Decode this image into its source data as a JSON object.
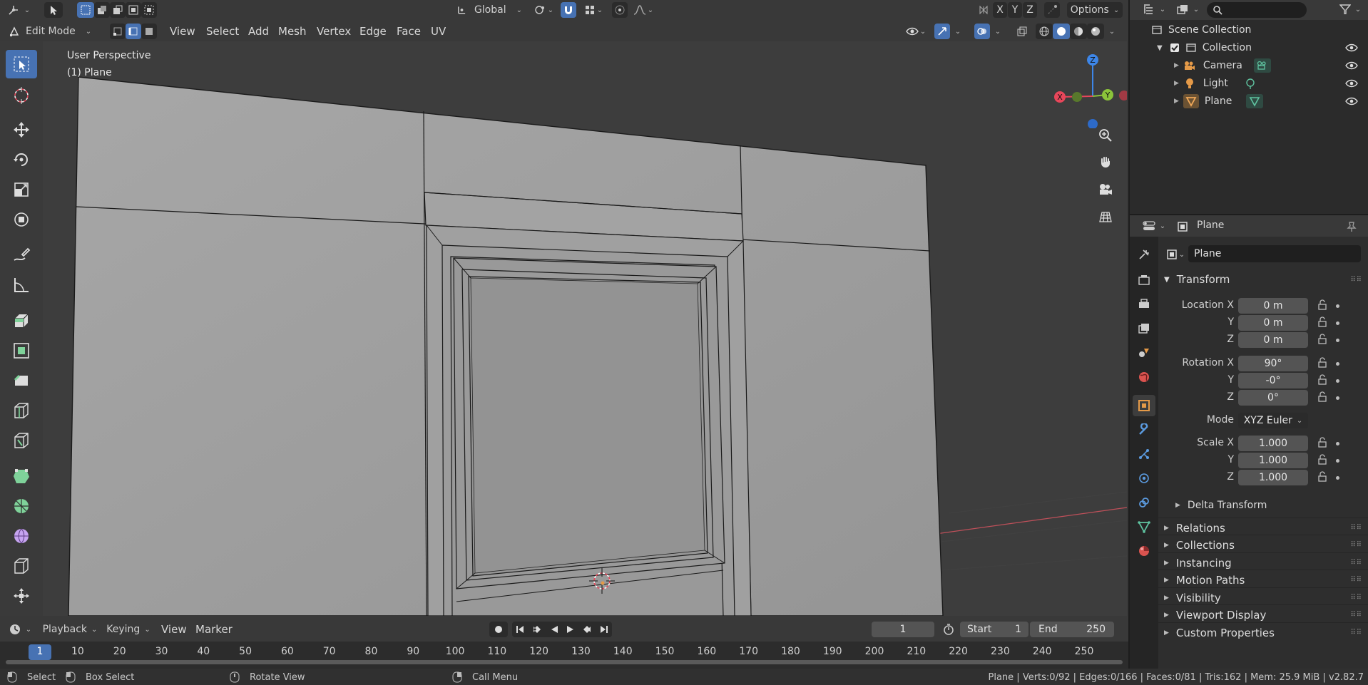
{
  "header": {
    "transform_orientation": "Global",
    "options_label": "Options",
    "axis_x": "X",
    "axis_y": "Y",
    "axis_z": "Z"
  },
  "editbar": {
    "mode": "Edit Mode",
    "menus": [
      "View",
      "Select",
      "Add",
      "Mesh",
      "Vertex",
      "Edge",
      "Face",
      "UV"
    ]
  },
  "viewport": {
    "perspective_label": "User Perspective",
    "object_label": "(1) Plane",
    "gizmo": {
      "x": "X",
      "y": "Y",
      "z": "Z"
    }
  },
  "timeline": {
    "menus": [
      "Playback",
      "Keying",
      "View",
      "Marker"
    ],
    "current_frame": "1",
    "start_label": "Start",
    "start_value": "1",
    "end_label": "End",
    "end_value": "250",
    "ticks": [
      "1",
      "10",
      "20",
      "30",
      "40",
      "50",
      "60",
      "70",
      "80",
      "90",
      "100",
      "110",
      "120",
      "130",
      "140",
      "150",
      "160",
      "170",
      "180",
      "190",
      "200",
      "210",
      "220",
      "230",
      "240",
      "250"
    ]
  },
  "statusbar": {
    "select": "Select",
    "box_select": "Box Select",
    "rotate_view": "Rotate View",
    "call_menu": "Call Menu",
    "stats": "Plane | Verts:0/92 | Edges:0/166 | Faces:0/81 | Tris:162 | Mem: 25.9 MiB | v2.82.7"
  },
  "outliner": {
    "scene_collection": "Scene Collection",
    "collection": "Collection",
    "items": [
      "Camera",
      "Light",
      "Plane"
    ]
  },
  "properties": {
    "header_object": "Plane",
    "object_name": "Plane",
    "transform_title": "Transform",
    "location_label": "Location X",
    "location": [
      "0 m",
      "0 m",
      "0 m"
    ],
    "rotation_label": "Rotation X",
    "rotation": [
      "90°",
      "-0°",
      "0°"
    ],
    "mode_label": "Mode",
    "mode_value": "XYZ Euler",
    "scale_label": "Scale X",
    "scale": [
      "1.000",
      "1.000",
      "1.000"
    ],
    "y_label": "Y",
    "z_label": "Z",
    "delta_transform": "Delta Transform",
    "sections": [
      "Relations",
      "Collections",
      "Instancing",
      "Motion Paths",
      "Visibility",
      "Viewport Display",
      "Custom Properties"
    ]
  },
  "colors": {
    "accent": "#4772b3",
    "axis_x": "#e8465a",
    "axis_y": "#8bc33a",
    "axis_z": "#3d86e8",
    "orange": "#e59a48"
  }
}
